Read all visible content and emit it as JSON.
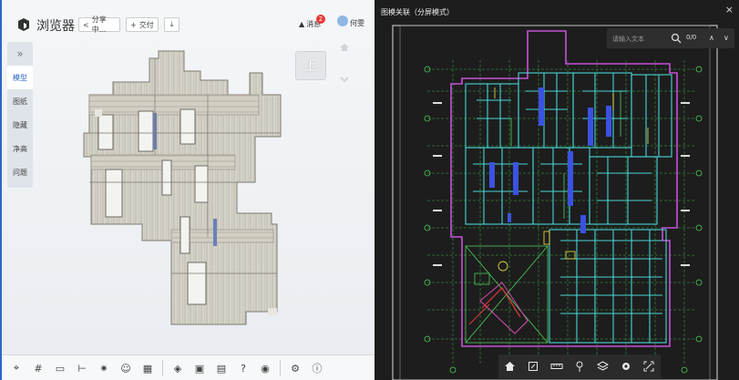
{
  "app": {
    "title": "浏览器"
  },
  "toolbar": {
    "share_label": "分享中...",
    "deliver_label": "交付",
    "notice_label": "消息",
    "notice_count": "2",
    "username": "何雯"
  },
  "sidenav": {
    "items": [
      {
        "label": "模型",
        "active": true
      },
      {
        "label": "图纸"
      },
      {
        "label": "隐藏"
      },
      {
        "label": "净高"
      },
      {
        "label": "问题"
      }
    ]
  },
  "viewcube": {
    "face": "上"
  },
  "right": {
    "title": "图模关联（分屏模式）"
  },
  "search": {
    "placeholder": "请输入文本",
    "count": "0/0"
  },
  "colors": {
    "accent": "#2e66c7",
    "drawing_bg": "#1d1d1d",
    "cad_green": "#4fd05a",
    "cad_cyan": "#46d5d5",
    "cad_magenta": "#c850d8",
    "cad_blue": "#3b52e0"
  },
  "bottom_tools": [
    "measure-icon",
    "grid-icon",
    "section-icon",
    "dimension-icon",
    "explode-icon",
    "person-icon",
    "table-icon",
    "3d-icon",
    "camera-icon",
    "comment-icon",
    "help-icon",
    "eye-icon",
    "settings-icon",
    "info-icon"
  ],
  "drawing_tools": [
    "home-icon",
    "frame-icon",
    "ruler-icon",
    "pin-icon",
    "layers-icon",
    "settings-icon",
    "fullscreen-icon"
  ]
}
